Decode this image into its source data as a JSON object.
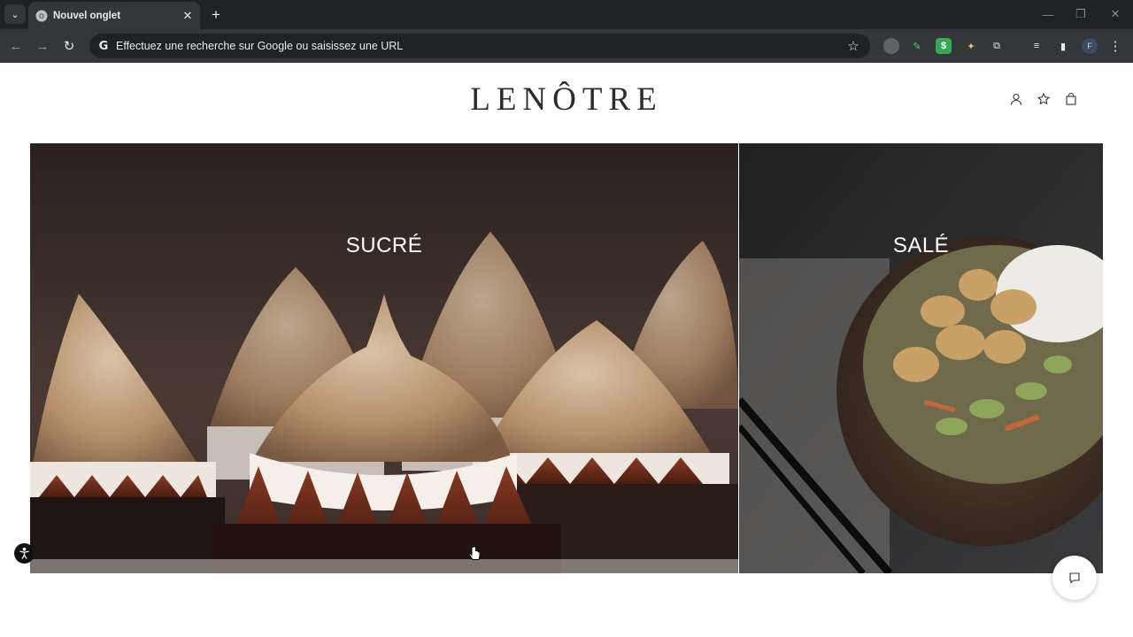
{
  "browser": {
    "tab_title": "Nouvel onglet",
    "tab_close": "✕",
    "new_tab": "+",
    "tab_search": "⌄",
    "omnibox_placeholder": "Effectuez une recherche sur Google ou saisissez une URL",
    "profile_initial": "F",
    "window_controls": {
      "minimize": "—",
      "restore": "❐",
      "close": "✕"
    }
  },
  "site": {
    "logo": "LENÔTRE",
    "header_icons": [
      "account-icon",
      "wishlist-star-icon",
      "shopping-bag-icon"
    ]
  },
  "categories": [
    {
      "label": "SUCRÉ"
    },
    {
      "label": "SALÉ"
    }
  ],
  "colors": {
    "chrome_dark": "#202124",
    "chrome_toolbar": "#35363a",
    "page_bg": "#ffffff",
    "logo": "#2b2b2b"
  }
}
